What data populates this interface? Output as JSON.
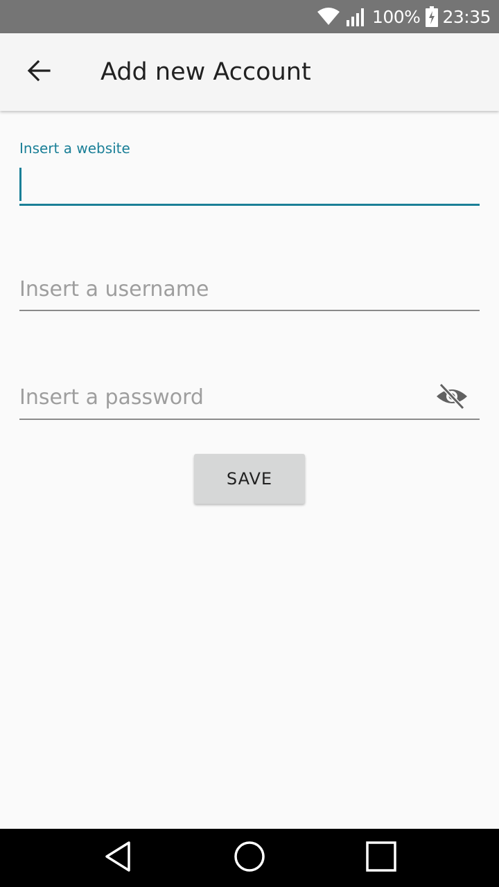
{
  "status_bar": {
    "battery_percent": "100%",
    "time": "23:35",
    "icons": [
      "wifi-icon",
      "signal-icon",
      "battery-charging-icon"
    ]
  },
  "app_bar": {
    "title": "Add new Account",
    "back_icon": "arrow-back-icon"
  },
  "form": {
    "website": {
      "label": "Insert a website",
      "value": ""
    },
    "username": {
      "placeholder": "Insert a username",
      "value": ""
    },
    "password": {
      "placeholder": "Insert a password",
      "value": "",
      "toggle_icon": "visibility-off-icon"
    },
    "save_label": "SAVE"
  },
  "nav_bar": {
    "icons": [
      "nav-back-icon",
      "nav-home-icon",
      "nav-recents-icon"
    ]
  },
  "colors": {
    "accent": "#1a7f97",
    "status_bar": "#757575",
    "app_bar": "#f5f5f5",
    "background": "#fafafa",
    "button": "#d6d7d7"
  }
}
